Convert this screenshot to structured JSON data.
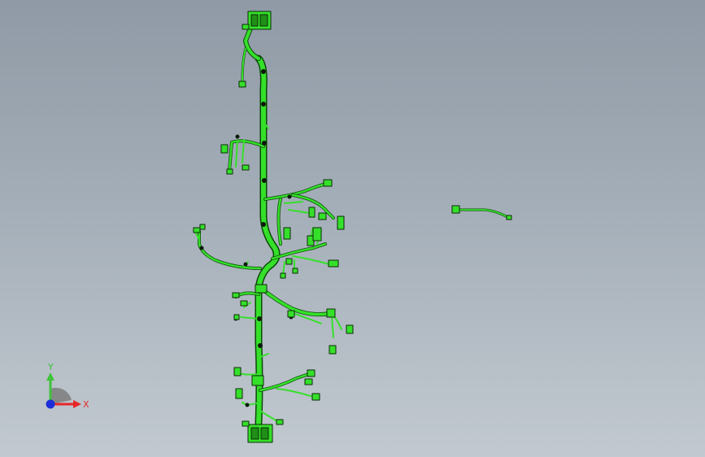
{
  "viewport": {
    "model": "wire-harness-assembly"
  },
  "colors": {
    "harness": "#35e02a",
    "harness_dark": "#0b4a08",
    "outline": "#0a2a06",
    "axis_x": "#e8262a",
    "axis_y": "#3fc23a",
    "axis_z": "#1c2fd8",
    "triad_shadow": "#7c7c7c"
  },
  "triad": {
    "x_label": "X",
    "y_label": "Y"
  }
}
